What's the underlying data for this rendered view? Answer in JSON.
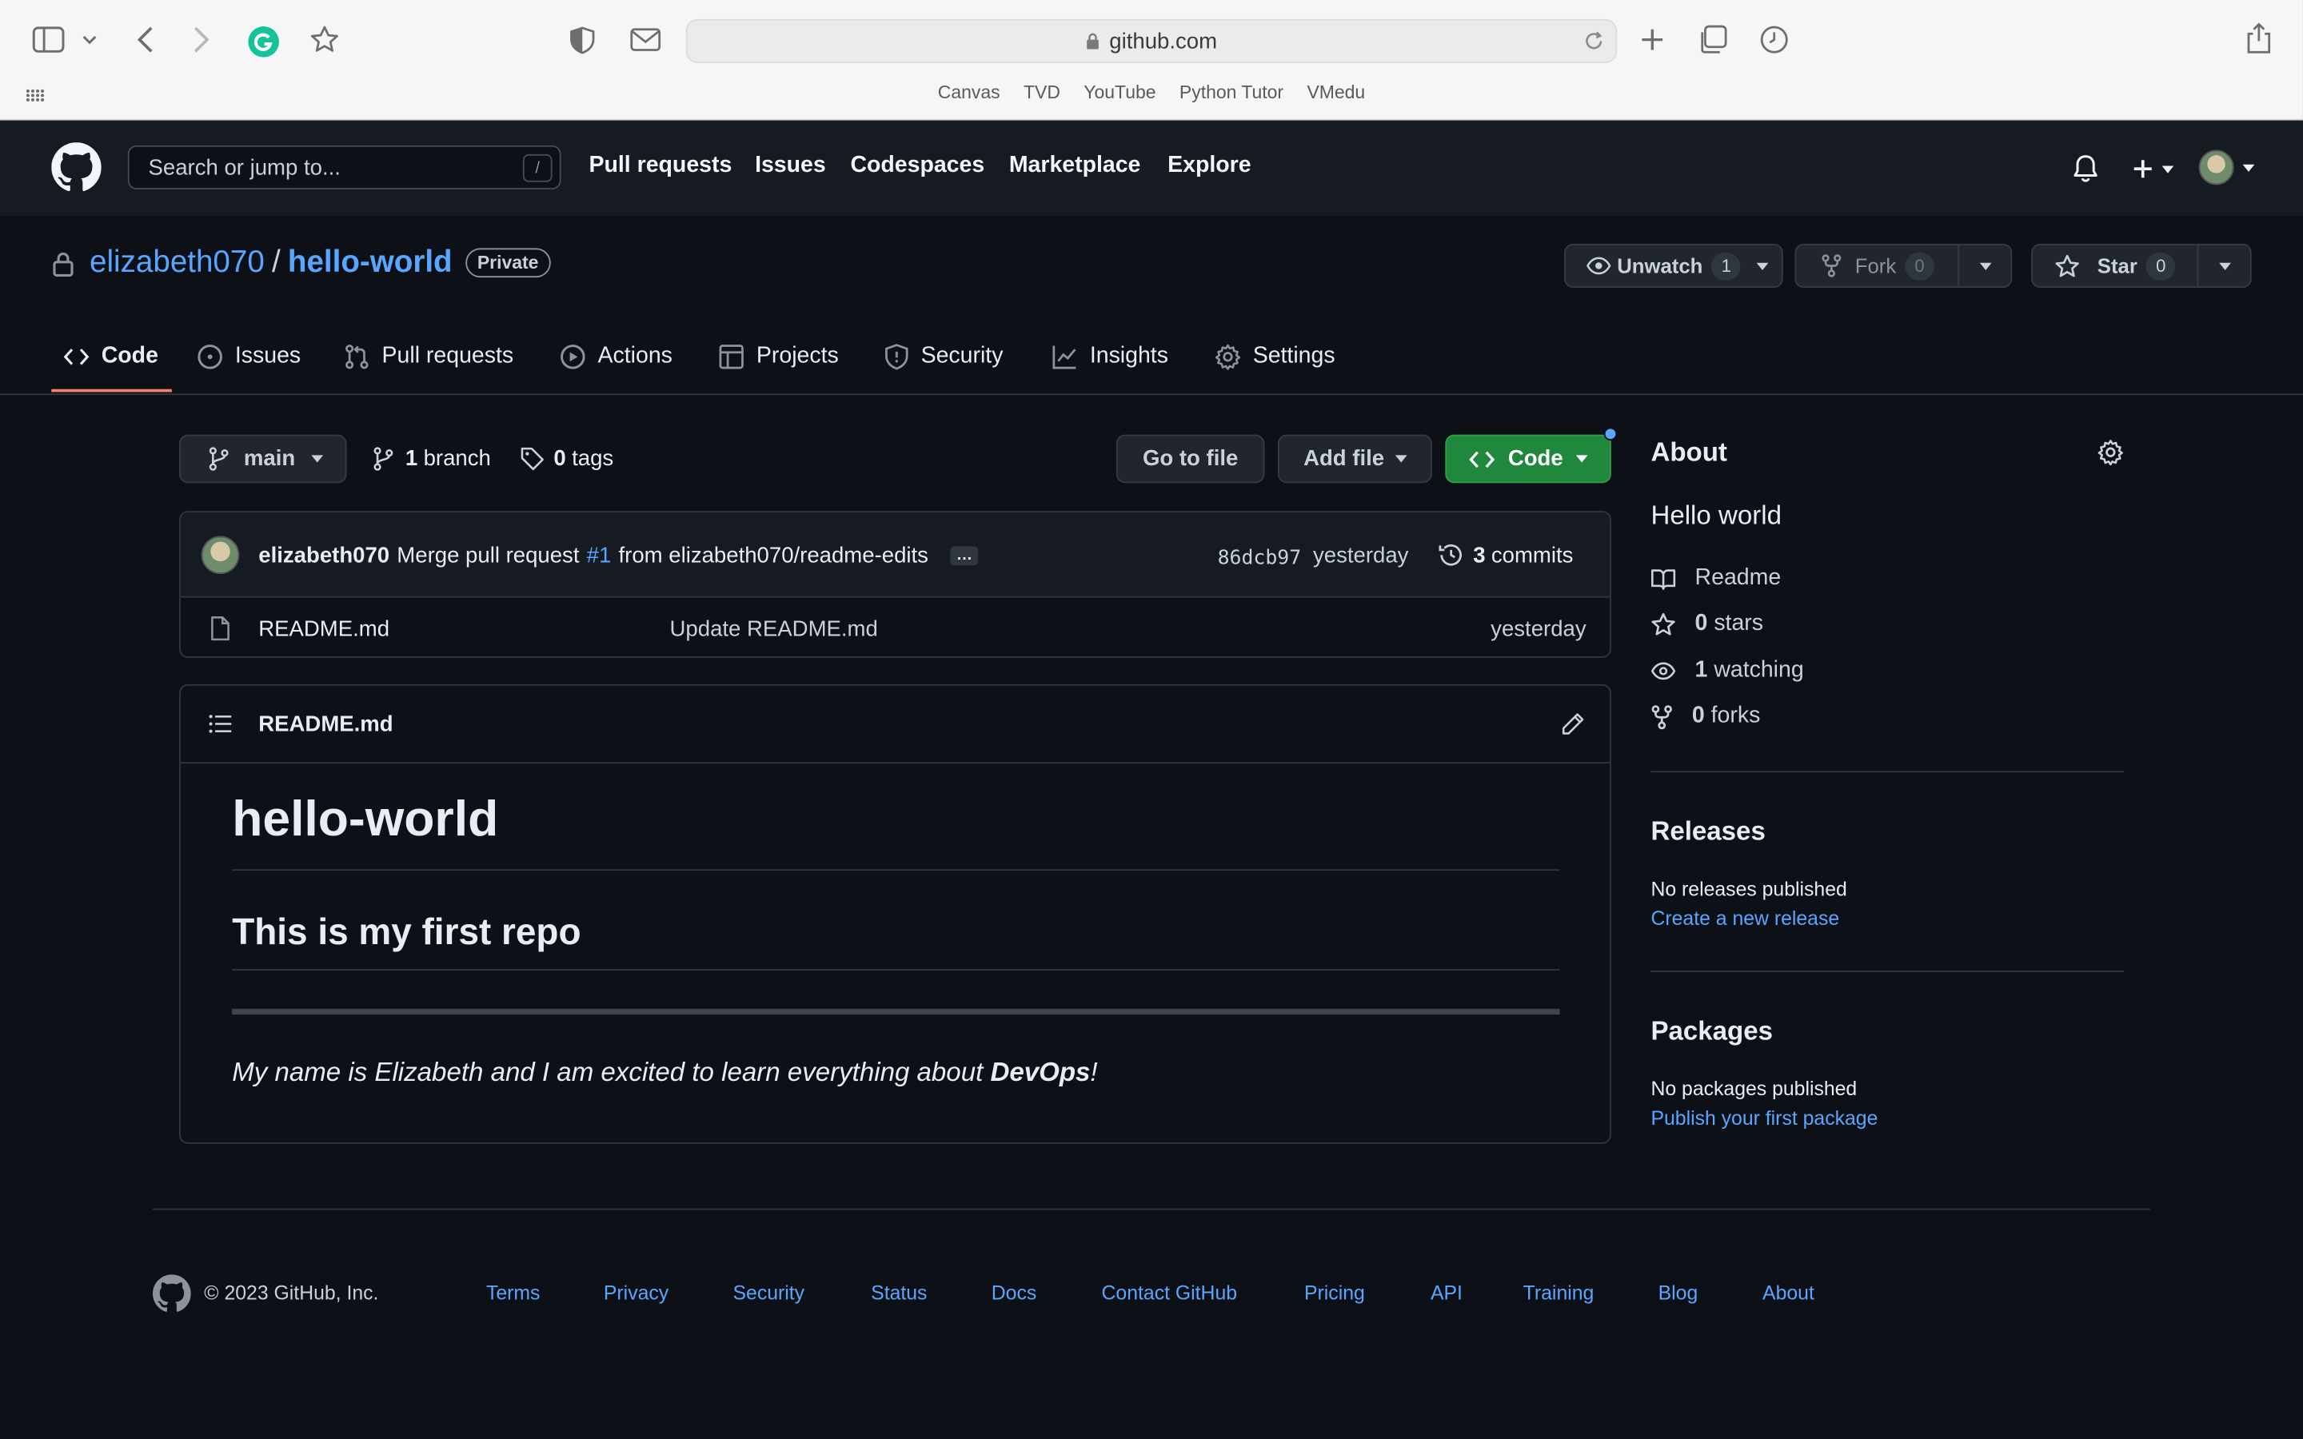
{
  "browser": {
    "url": "github.com",
    "bookmarks": [
      "Canvas",
      "TVD",
      "YouTube",
      "Python Tutor",
      "VMedu"
    ]
  },
  "header": {
    "search_placeholder": "Search or jump to...",
    "search_shortcut": "/",
    "nav": [
      "Pull requests",
      "Issues",
      "Codespaces",
      "Marketplace",
      "Explore"
    ]
  },
  "repo": {
    "owner": "elizabeth070",
    "separator": "/",
    "name": "hello-world",
    "visibility": "Private",
    "unwatch_label": "Unwatch",
    "watch_count": "1",
    "fork_label": "Fork",
    "fork_count": "0",
    "star_label": "Star",
    "star_count": "0"
  },
  "tabs": [
    "Code",
    "Issues",
    "Pull requests",
    "Actions",
    "Projects",
    "Security",
    "Insights",
    "Settings"
  ],
  "toolbar": {
    "branch": "main",
    "branch_count": "1",
    "branch_label": "branch",
    "tag_count": "0",
    "tag_label": "tags",
    "go_to_file": "Go to file",
    "add_file": "Add file",
    "code": "Code"
  },
  "commit": {
    "author": "elizabeth070",
    "message_prefix": "Merge pull request",
    "pr_ref": "#1",
    "message_suffix": "from elizabeth070/readme-edits",
    "ellipsis": "…",
    "sha": "86dcb97",
    "time": "yesterday",
    "commit_count": "3",
    "commit_label": "commits"
  },
  "files": [
    {
      "name": "README.md",
      "message": "Update README.md",
      "time": "yesterday"
    }
  ],
  "readme": {
    "filename": "README.md",
    "h1": "hello-world",
    "h2": "This is my first repo",
    "text_before": "My name is Elizabeth and I am excited to learn everything about ",
    "text_bold": "DevOps",
    "text_after": "!"
  },
  "about": {
    "heading": "About",
    "description": "Hello world",
    "readme": "Readme",
    "stars_count": "0",
    "stars_label": "stars",
    "watching_count": "1",
    "watching_label": "watching",
    "forks_count": "0",
    "forks_label": "forks"
  },
  "releases": {
    "heading": "Releases",
    "none": "No releases published",
    "create_link": "Create a new release"
  },
  "packages": {
    "heading": "Packages",
    "none": "No packages published",
    "publish_link": "Publish your first package"
  },
  "footer": {
    "copyright": "© 2023 GitHub, Inc.",
    "links": [
      "Terms",
      "Privacy",
      "Security",
      "Status",
      "Docs",
      "Contact GitHub",
      "Pricing",
      "API",
      "Training",
      "Blog",
      "About"
    ]
  },
  "colors": {
    "page_bg": "#0d1117",
    "header_bg": "#161b22",
    "link": "#58a6ff",
    "primary_button": "#1f883d",
    "tab_accent": "#f78166"
  }
}
